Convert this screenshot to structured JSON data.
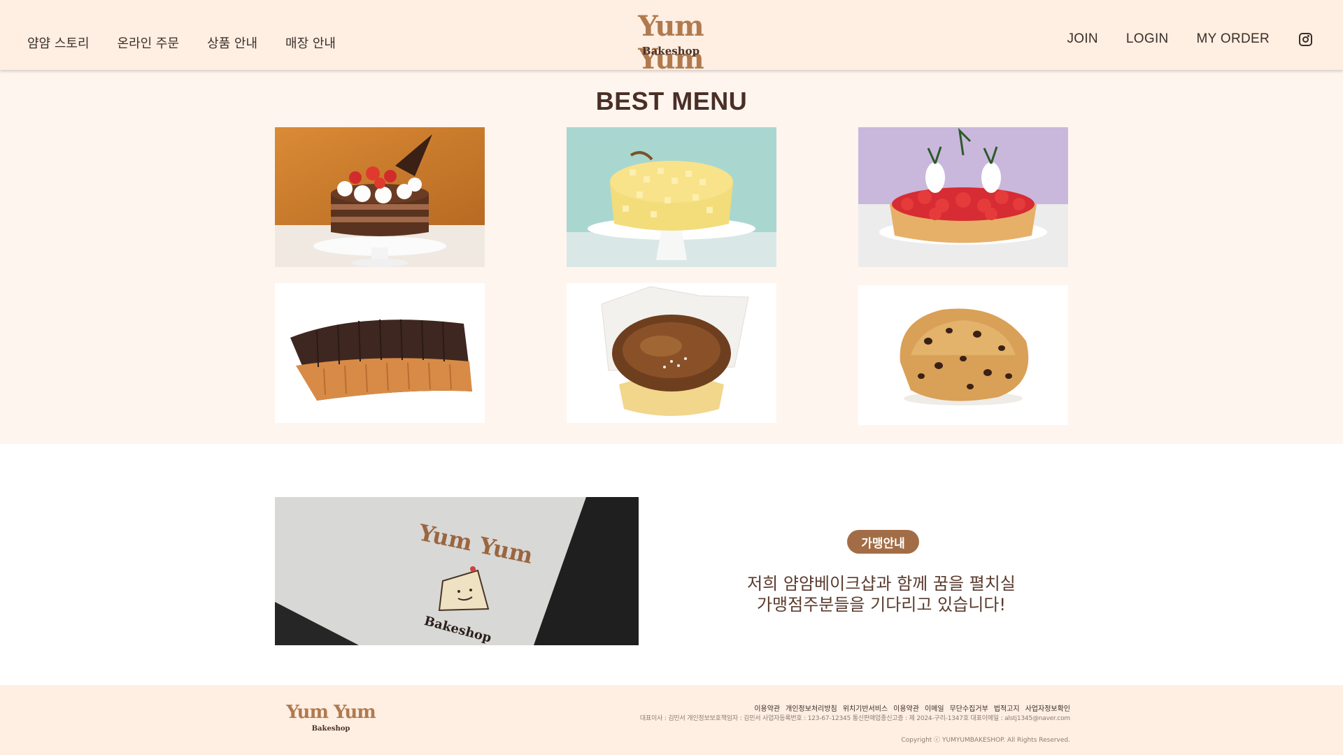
{
  "header": {
    "nav_left": [
      "얌얌 스토리",
      "온라인 주문",
      "상품 안내",
      "매장 안내"
    ],
    "logo": {
      "title": "Yum Yum",
      "subtitle": "Bakeshop"
    },
    "nav_right": [
      "JOIN",
      "LOGIN",
      "MY ORDER"
    ],
    "instagram_icon": "instagram-icon"
  },
  "best_menu": {
    "title": "BEST MENU",
    "items": [
      {
        "name": "chocolate strawberry cake"
      },
      {
        "name": "cheese cube cake"
      },
      {
        "name": "strawberry tart"
      },
      {
        "name": "chocolate dipped pie"
      },
      {
        "name": "basque cheesecake"
      },
      {
        "name": "chocolate chip scone"
      }
    ]
  },
  "franchise": {
    "badge": "가맹안내",
    "line1": "저희 얌얌베이크샵과 함께 꿈을 펼치실",
    "line2": "가맹점주분들을 기다리고 있습니다!",
    "image_logo": {
      "title": "Yum Yum",
      "subtitle": "Bakeshop"
    }
  },
  "footer": {
    "logo": {
      "title": "Yum Yum",
      "subtitle": "Bakeshop"
    },
    "links": [
      "이용약관",
      "개인정보처리방침",
      "위치기반서비스",
      "이용약관",
      "이메일",
      "무단수집거부",
      "법적고지",
      "사업자정보확인"
    ],
    "info": "대표이사 : 김민서  개인정보보호책임자 : 김민서  사업자등록번호 : 123-67-12345 통신판매업종신고증 : 제 2024-구리-1347호  대표이메일 : alstj1345@naver.com",
    "copyright": "Copyright ⓒ YUMYUMBAKESHOP. All Rights Reserved."
  },
  "colors": {
    "header_bg": "#ffeee2",
    "section_bg": "#fff5ef",
    "brand_brown": "#b07a4e",
    "badge_bg": "#a26d46",
    "text_dark": "#3a2e28"
  }
}
